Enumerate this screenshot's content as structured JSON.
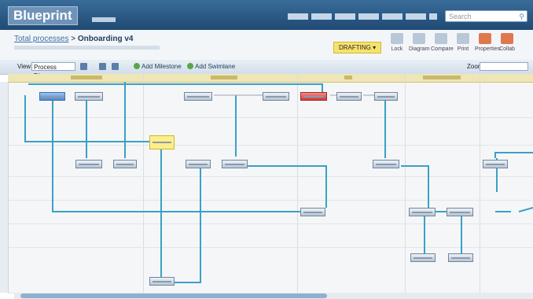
{
  "app": {
    "logo": "Blueprint"
  },
  "search": {
    "placeholder": "Search",
    "icon": "search-icon"
  },
  "header": {
    "breadcrumb_link": "Total processes",
    "title": "Onboarding v4",
    "status": "DRAFTING ▾"
  },
  "tools": [
    {
      "label": "Lock",
      "icon": "lock-icon"
    },
    {
      "label": "Diagram",
      "icon": "diagram-icon"
    },
    {
      "label": "Compare",
      "icon": "compare-icon"
    },
    {
      "label": "Print",
      "icon": "print-icon"
    },
    {
      "label": "Properties",
      "icon": "properties-icon"
    },
    {
      "label": "Collab",
      "icon": "collab-icon"
    }
  ],
  "toolbar": {
    "view_label": "View:",
    "view_value": "Process Diagram",
    "add_milestone": "Add Milestone",
    "add_swimlane": "Add Swimlane",
    "zoom_label": "Zoom"
  },
  "colors": {
    "accent": "#3a6c9a",
    "node_blue": "#4f89cf",
    "node_red": "#d33b3b",
    "note": "#fbef8a",
    "link": "#3aa0c8"
  }
}
